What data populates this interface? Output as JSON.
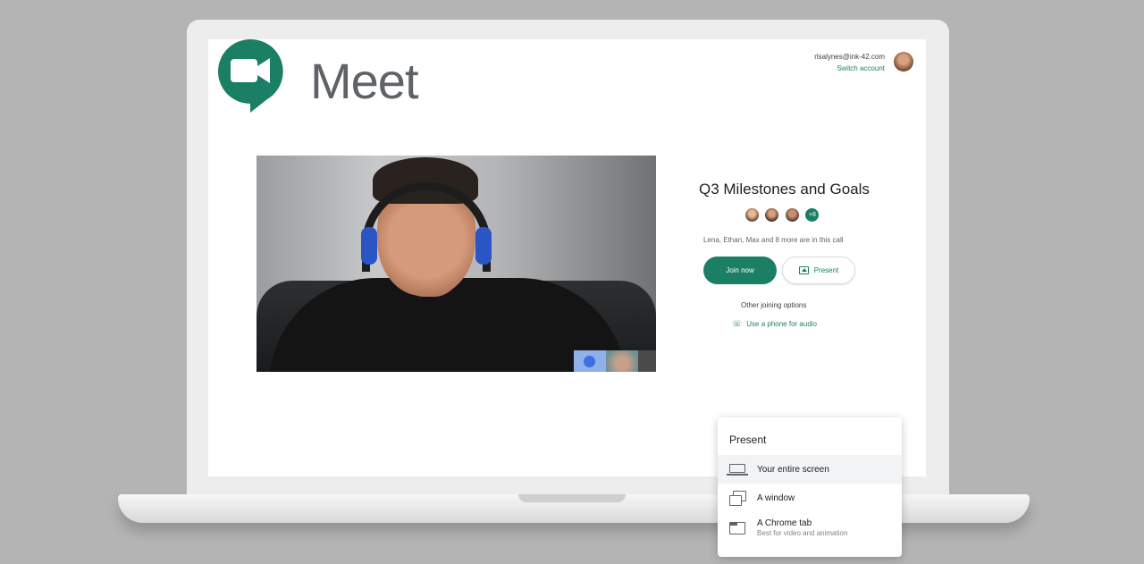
{
  "app": {
    "brand": "Meet"
  },
  "account": {
    "email": "rlsalynes@ink-42.com",
    "switch_label": "Switch account"
  },
  "meeting": {
    "title": "Q3 Milestones and Goals",
    "extra_participants_badge": "+8",
    "in_call_text": "Lena, Ethan, Max and 8 more are in this call",
    "join_label": "Join now",
    "present_label": "Present",
    "other_options_label": "Other joining options",
    "phone_audio_label": "Use a phone for audio"
  },
  "present_menu": {
    "title": "Present",
    "items": [
      {
        "label": "Your entire screen",
        "icon": "monitor-icon"
      },
      {
        "label": "A window",
        "icon": "window-icon"
      },
      {
        "label": "A Chrome tab",
        "sublabel": "Best for video and animation",
        "icon": "browser-tab-icon"
      }
    ]
  },
  "colors": {
    "accent": "#1a7f64",
    "background": "#b3b4b3",
    "text_primary": "#202124",
    "text_secondary": "#5f6368"
  }
}
